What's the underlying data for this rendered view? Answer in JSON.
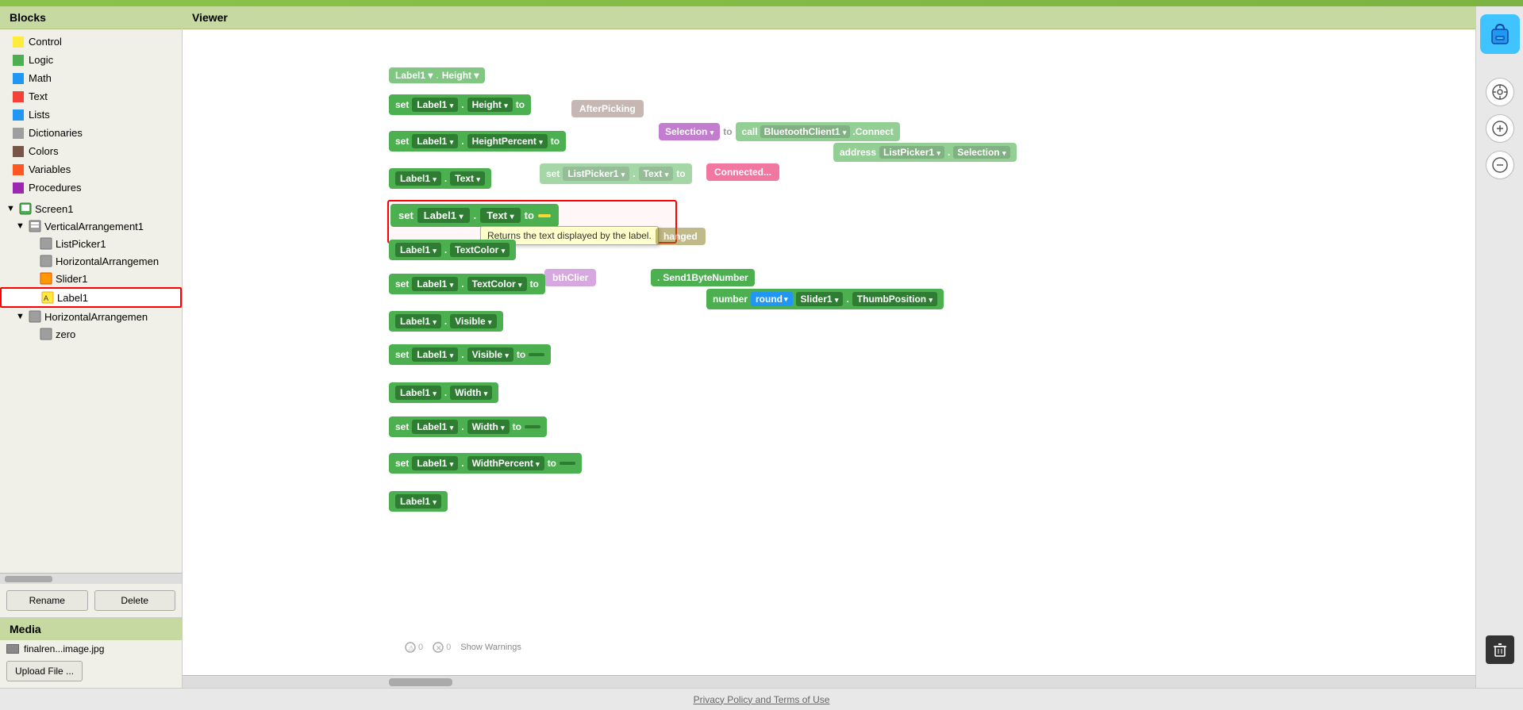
{
  "sidebar": {
    "blocks_header": "Blocks",
    "items": [
      {
        "id": "control",
        "label": "Control",
        "color": "#FFEB3B"
      },
      {
        "id": "logic",
        "label": "Logic",
        "color": "#4CAF50"
      },
      {
        "id": "math",
        "label": "Math",
        "color": "#2196F3"
      },
      {
        "id": "text",
        "label": "Text",
        "color": "#F44336"
      },
      {
        "id": "lists",
        "label": "Lists",
        "color": "#2196F3"
      },
      {
        "id": "dictionaries",
        "label": "Dictionaries",
        "color": "#9E9E9E"
      },
      {
        "id": "colors",
        "label": "Colors",
        "color": "#795548"
      },
      {
        "id": "variables",
        "label": "Variables",
        "color": "#FF5722"
      },
      {
        "id": "procedures",
        "label": "Procedures",
        "color": "#9C27B0"
      }
    ],
    "tree": {
      "screen1": "Screen1",
      "vertical_arrangement": "VerticalArrangement1",
      "list_picker": "ListPicker1",
      "horizontal_arrangement": "HorizontalArrangemen",
      "slider1": "Slider1",
      "label1": "Label1",
      "horizontal_arrangement2": "HorizontalArrangemen",
      "zero": "zero"
    },
    "rename_btn": "Rename",
    "delete_btn": "Delete"
  },
  "media": {
    "header": "Media",
    "file": "finalren...image.jpg",
    "upload_btn": "Upload File ..."
  },
  "viewer": {
    "header": "Viewer"
  },
  "blocks_on_canvas": {
    "tooltip_text": "Returns the text displayed by the label."
  },
  "right_toolbar": {
    "target_icon": "⊕",
    "zoom_in_icon": "+",
    "zoom_out_icon": "−",
    "trash_icon": "🗑"
  },
  "footer": {
    "link_text": "Privacy Policy and Terms of Use"
  }
}
